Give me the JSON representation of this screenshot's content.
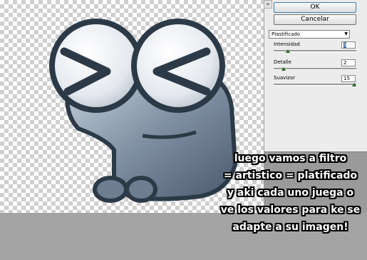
{
  "dialog": {
    "ok_label": "OK",
    "cancel_label": "Cancelar",
    "filter_select": "Plastificado",
    "params": [
      {
        "label": "Intensidad",
        "value": "3",
        "slider_fraction": 0.15
      },
      {
        "label": "Detalle",
        "value": "2",
        "slider_fraction": 0.1
      },
      {
        "label": "Suavizar",
        "value": "15",
        "slider_fraction": 1.0
      }
    ]
  },
  "caption": {
    "lines": [
      "luego vamos a filtro",
      "= artistico = platificado",
      "y aki cada uno juega o",
      "ve los valores para ke se",
      "adapte a su imagen!"
    ]
  },
  "colors": {
    "accent": "#3c7fb1",
    "slider_thumb": "#2a6a2a"
  }
}
